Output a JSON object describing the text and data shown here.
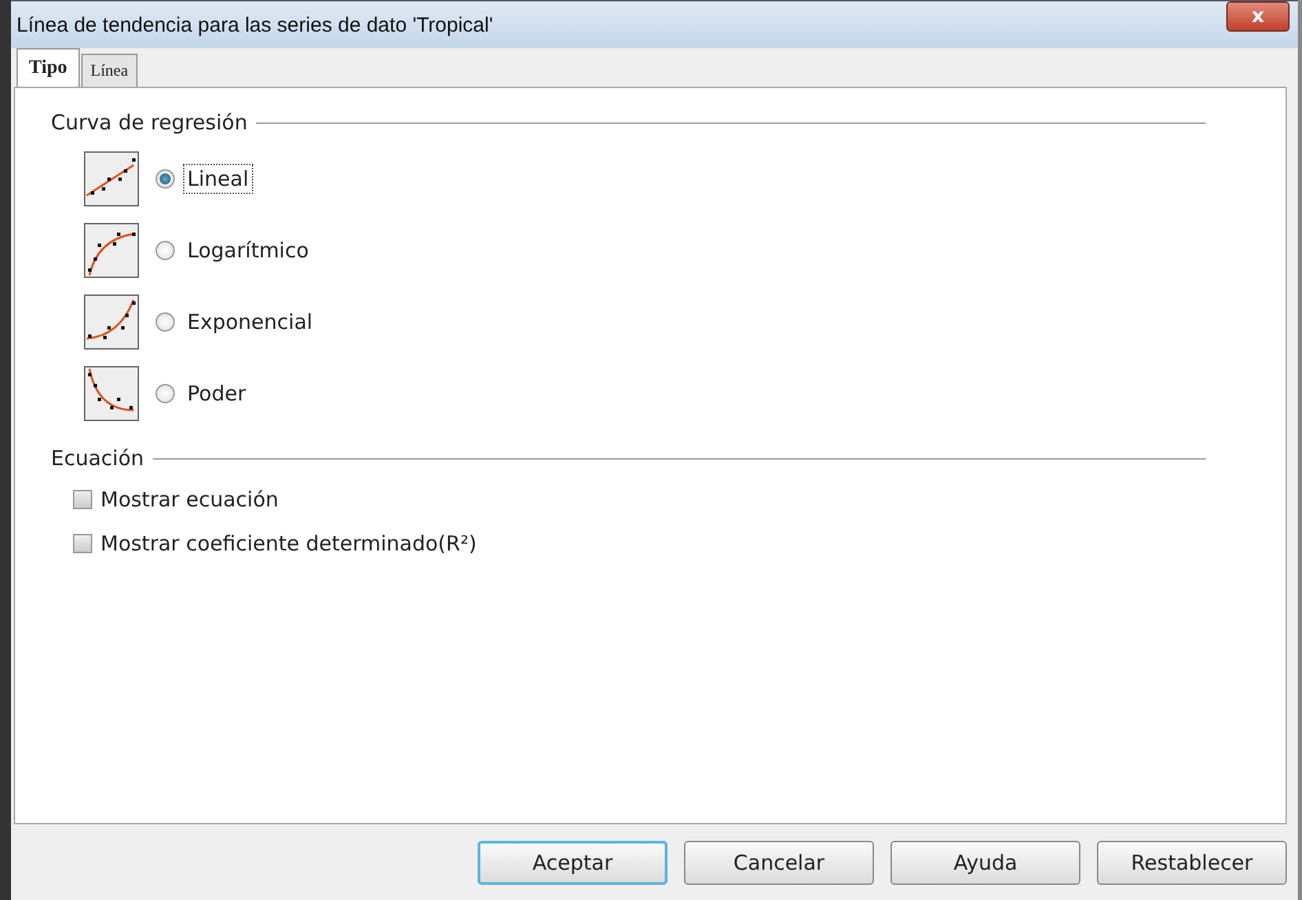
{
  "window": {
    "title": "Línea de tendencia para las series de dato 'Tropical'",
    "close": "x"
  },
  "tabs": [
    {
      "label": "Tipo",
      "selected": true
    },
    {
      "label": "Línea",
      "selected": false
    }
  ],
  "regression": {
    "title": "Curva de regresión",
    "options": [
      {
        "kind": "linear",
        "label": "Lineal",
        "selected": true
      },
      {
        "kind": "logarithmic",
        "label": "Logarítmico",
        "selected": false
      },
      {
        "kind": "exponential",
        "label": "Exponencial",
        "selected": false
      },
      {
        "kind": "power",
        "label": "Poder",
        "selected": false
      }
    ]
  },
  "equation": {
    "title": "Ecuación",
    "options": [
      {
        "label": "Mostrar ecuación",
        "checked": false
      },
      {
        "label": "Mostrar coeficiente determinado(R²)",
        "checked": false
      }
    ]
  },
  "buttons": [
    {
      "label": "Aceptar",
      "default": true
    },
    {
      "label": "Cancelar",
      "default": false
    },
    {
      "label": "Ayuda",
      "default": false
    },
    {
      "label": "Restablecer",
      "default": false
    }
  ]
}
